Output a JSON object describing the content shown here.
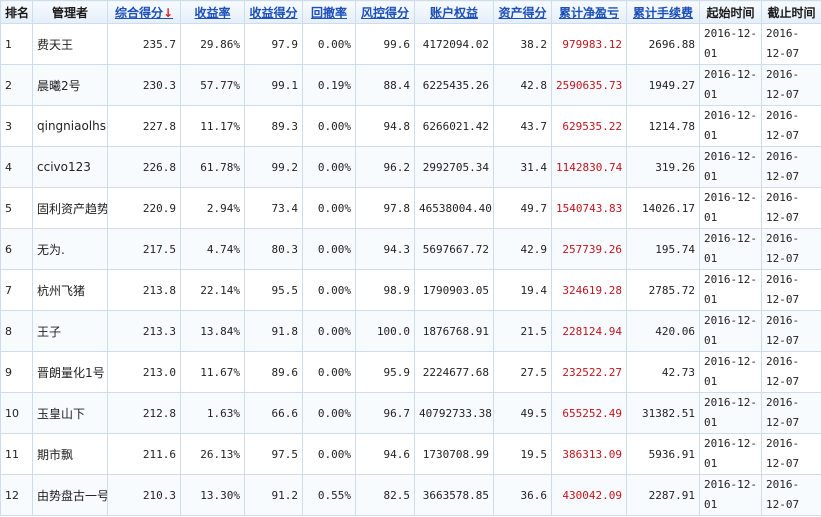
{
  "headers": [
    {
      "key": "rank",
      "label": "排名",
      "link": false
    },
    {
      "key": "manager",
      "label": "管理者",
      "link": false
    },
    {
      "key": "score",
      "label": "综合得分",
      "link": true,
      "sorted": true
    },
    {
      "key": "return_rate",
      "label": "收益率",
      "link": true
    },
    {
      "key": "return_score",
      "label": "收益得分",
      "link": true
    },
    {
      "key": "drawdown",
      "label": "回撤率",
      "link": true
    },
    {
      "key": "risk_score",
      "label": "风控得分",
      "link": true
    },
    {
      "key": "equity",
      "label": "账户权益",
      "link": true
    },
    {
      "key": "asset_score",
      "label": "资产得分",
      "link": true
    },
    {
      "key": "net_pl",
      "label": "累计净盈亏",
      "link": true
    },
    {
      "key": "fees",
      "label": "累计手续费",
      "link": true
    },
    {
      "key": "start",
      "label": "起始时间",
      "link": false
    },
    {
      "key": "end",
      "label": "截止时间",
      "link": false
    }
  ],
  "sort_arrow": "↓",
  "rows": [
    {
      "rank": "1",
      "manager": "费天王",
      "score": "235.7",
      "return_rate": "29.86%",
      "return_score": "97.9",
      "drawdown": "0.00%",
      "risk_score": "99.6",
      "equity": "4172094.02",
      "asset_score": "38.2",
      "net_pl": "979983.12",
      "fees": "2696.88",
      "start": "2016-12-01",
      "end": "2016-12-07"
    },
    {
      "rank": "2",
      "manager": "晨曦2号",
      "score": "230.3",
      "return_rate": "57.77%",
      "return_score": "99.1",
      "drawdown": "0.19%",
      "risk_score": "88.4",
      "equity": "6225435.26",
      "asset_score": "42.8",
      "net_pl": "2590635.73",
      "fees": "1949.27",
      "start": "2016-12-01",
      "end": "2016-12-07"
    },
    {
      "rank": "3",
      "manager": "qingniaolhs",
      "score": "227.8",
      "return_rate": "11.17%",
      "return_score": "89.3",
      "drawdown": "0.00%",
      "risk_score": "94.8",
      "equity": "6266021.42",
      "asset_score": "43.7",
      "net_pl": "629535.22",
      "fees": "1214.78",
      "start": "2016-12-01",
      "end": "2016-12-07"
    },
    {
      "rank": "4",
      "manager": "ccivo123",
      "score": "226.8",
      "return_rate": "61.78%",
      "return_score": "99.2",
      "drawdown": "0.00%",
      "risk_score": "96.2",
      "equity": "2992705.34",
      "asset_score": "31.4",
      "net_pl": "1142830.74",
      "fees": "319.26",
      "start": "2016-12-01",
      "end": "2016-12-07"
    },
    {
      "rank": "5",
      "manager": "固利资产趋势",
      "score": "220.9",
      "return_rate": "2.94%",
      "return_score": "73.4",
      "drawdown": "0.00%",
      "risk_score": "97.8",
      "equity": "46538004.40",
      "asset_score": "49.7",
      "net_pl": "1540743.83",
      "fees": "14026.17",
      "start": "2016-12-01",
      "end": "2016-12-07"
    },
    {
      "rank": "6",
      "manager": "无为.",
      "score": "217.5",
      "return_rate": "4.74%",
      "return_score": "80.3",
      "drawdown": "0.00%",
      "risk_score": "94.3",
      "equity": "5697667.72",
      "asset_score": "42.9",
      "net_pl": "257739.26",
      "fees": "195.74",
      "start": "2016-12-01",
      "end": "2016-12-07"
    },
    {
      "rank": "7",
      "manager": "杭州飞猪",
      "score": "213.8",
      "return_rate": "22.14%",
      "return_score": "95.5",
      "drawdown": "0.00%",
      "risk_score": "98.9",
      "equity": "1790903.05",
      "asset_score": "19.4",
      "net_pl": "324619.28",
      "fees": "2785.72",
      "start": "2016-12-01",
      "end": "2016-12-07"
    },
    {
      "rank": "8",
      "manager": "王子",
      "score": "213.3",
      "return_rate": "13.84%",
      "return_score": "91.8",
      "drawdown": "0.00%",
      "risk_score": "100.0",
      "equity": "1876768.91",
      "asset_score": "21.5",
      "net_pl": "228124.94",
      "fees": "420.06",
      "start": "2016-12-01",
      "end": "2016-12-07"
    },
    {
      "rank": "9",
      "manager": "晋朗量化1号",
      "score": "213.0",
      "return_rate": "11.67%",
      "return_score": "89.6",
      "drawdown": "0.00%",
      "risk_score": "95.9",
      "equity": "2224677.68",
      "asset_score": "27.5",
      "net_pl": "232522.27",
      "fees": "42.73",
      "start": "2016-12-01",
      "end": "2016-12-07"
    },
    {
      "rank": "10",
      "manager": "玉皇山下",
      "score": "212.8",
      "return_rate": "1.63%",
      "return_score": "66.6",
      "drawdown": "0.00%",
      "risk_score": "96.7",
      "equity": "40792733.38",
      "asset_score": "49.5",
      "net_pl": "655252.49",
      "fees": "31382.51",
      "start": "2016-12-01",
      "end": "2016-12-07"
    },
    {
      "rank": "11",
      "manager": "期市飘",
      "score": "211.6",
      "return_rate": "26.13%",
      "return_score": "97.5",
      "drawdown": "0.00%",
      "risk_score": "94.6",
      "equity": "1730708.99",
      "asset_score": "19.5",
      "net_pl": "386313.09",
      "fees": "5936.91",
      "start": "2016-12-01",
      "end": "2016-12-07"
    },
    {
      "rank": "12",
      "manager": "由势盘古一号",
      "score": "210.3",
      "return_rate": "13.30%",
      "return_score": "91.2",
      "drawdown": "0.55%",
      "risk_score": "82.5",
      "equity": "3663578.85",
      "asset_score": "36.6",
      "net_pl": "430042.09",
      "fees": "2287.91",
      "start": "2016-12-01",
      "end": "2016-12-07"
    }
  ]
}
